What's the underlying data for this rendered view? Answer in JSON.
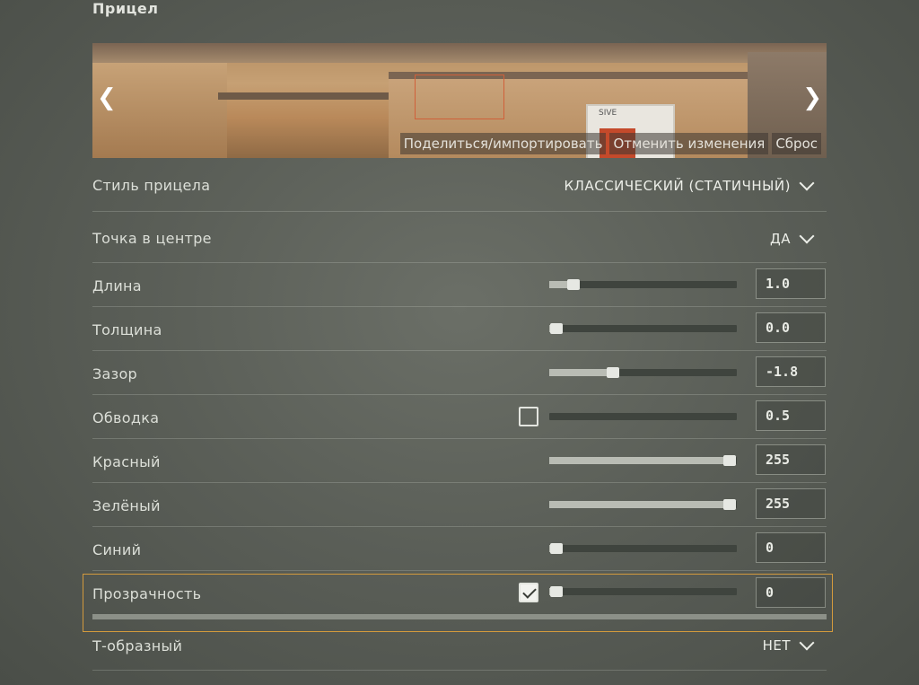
{
  "page_title": "Прицел",
  "preview": {
    "share_label": "Поделиться/импортировать",
    "revert_label": "Отменить изменения",
    "reset_label": "Сброс",
    "sign_text": "SIVE"
  },
  "rows": {
    "style": {
      "label": "Стиль прицела",
      "value": "КЛАССИЧЕСКИЙ (СТАТИЧНЫЙ)"
    },
    "center_dot": {
      "label": "Точка в центре",
      "value": "ДА"
    },
    "length": {
      "label": "Длина",
      "value": "1.0",
      "slider_level": 0.13
    },
    "thickness": {
      "label": "Толщина",
      "value": "0.0",
      "slider_level": 0.04
    },
    "gap": {
      "label": "Зазор",
      "value": "-1.8",
      "slider_level": 0.34
    },
    "outline": {
      "label": "Обводка",
      "value": "0.5",
      "checked": false,
      "slider_level": 0.0
    },
    "red": {
      "label": "Красный",
      "value": "255",
      "slider_level": 0.96
    },
    "green": {
      "label": "Зелёный",
      "value": "255",
      "slider_level": 0.96
    },
    "blue": {
      "label": "Синий",
      "value": "0",
      "slider_level": 0.04
    },
    "alpha": {
      "label": "Прозрачность",
      "value": "0",
      "checked": true,
      "slider_level": 0.04
    },
    "t_style": {
      "label": "Т-образный",
      "value": "НЕТ"
    }
  },
  "colors": {
    "accent_highlight": "#d39a3d",
    "crosshair_preview": "#d0603a"
  }
}
